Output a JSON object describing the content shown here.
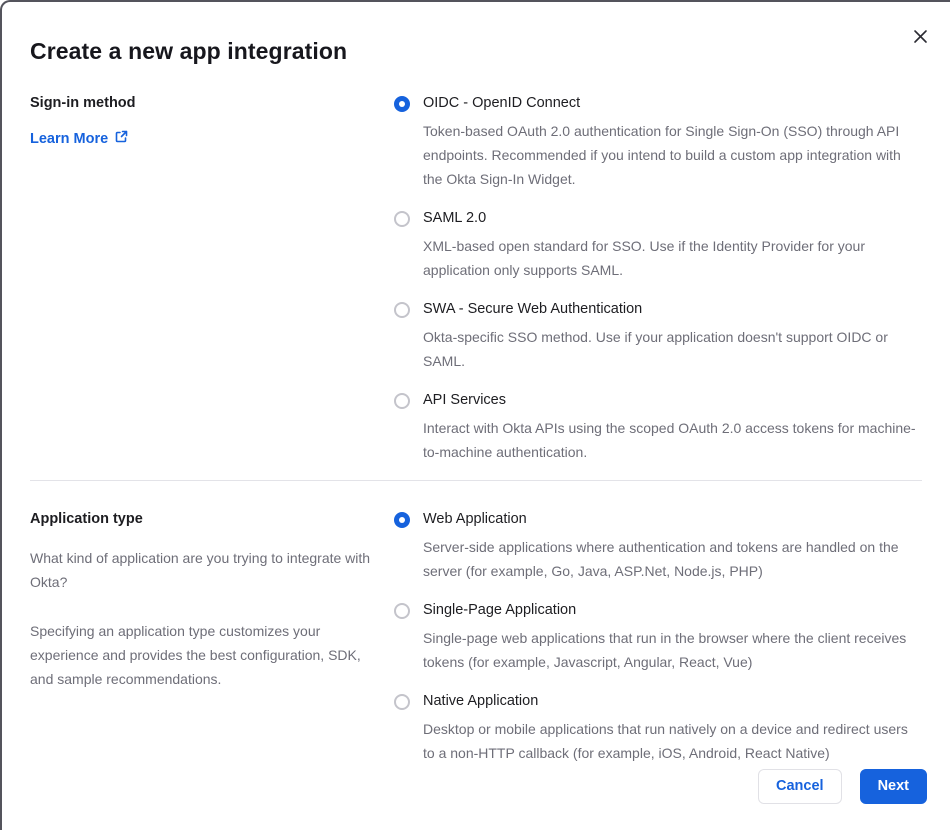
{
  "modal": {
    "title": "Create a new app integration"
  },
  "signin_section": {
    "label": "Sign-in method",
    "learn_more_label": "Learn More",
    "options": [
      {
        "label": "OIDC - OpenID Connect",
        "description": "Token-based OAuth 2.0 authentication for Single Sign-On (SSO) through API endpoints. Recommended if you intend to build a custom app integration with the Okta Sign-In Widget.",
        "selected": true
      },
      {
        "label": "SAML 2.0",
        "description": "XML-based open standard for SSO. Use if the Identity Provider for your application only supports SAML.",
        "selected": false
      },
      {
        "label": "SWA - Secure Web Authentication",
        "description": "Okta-specific SSO method. Use if your application doesn't support OIDC or SAML.",
        "selected": false
      },
      {
        "label": "API Services",
        "description": "Interact with Okta APIs using the scoped OAuth 2.0 access tokens for machine-to-machine authentication.",
        "selected": false
      }
    ]
  },
  "apptype_section": {
    "label": "Application type",
    "description_1": "What kind of application are you trying to integrate with Okta?",
    "description_2": "Specifying an application type customizes your experience and provides the best configuration, SDK, and sample recommendations.",
    "options": [
      {
        "label": "Web Application",
        "description": "Server-side applications where authentication and tokens are handled on the server (for example, Go, Java, ASP.Net, Node.js, PHP)",
        "selected": true
      },
      {
        "label": "Single-Page Application",
        "description": "Single-page web applications that run in the browser where the client receives tokens (for example, Javascript, Angular, React, Vue)",
        "selected": false
      },
      {
        "label": "Native Application",
        "description": "Desktop or mobile applications that run natively on a device and redirect users to a non-HTTP callback (for example, iOS, Android, React Native)",
        "selected": false
      }
    ]
  },
  "footer": {
    "cancel_label": "Cancel",
    "next_label": "Next"
  },
  "colors": {
    "primary_blue": "#1662dd",
    "text_dark": "#1d1d21",
    "text_gray": "#6e6e78",
    "radio_unselected_border": "#c4c4cb",
    "divider": "#e3e3e8",
    "modal_border": "#54545c"
  }
}
